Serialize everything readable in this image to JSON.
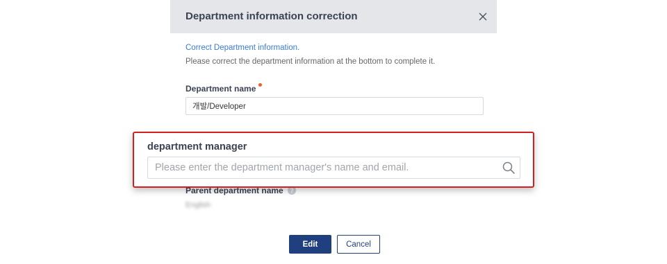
{
  "modal": {
    "title": "Department information correction",
    "close_icon": "close-icon",
    "intro_link": "Correct Department information.",
    "intro_text": "Please correct the department information at the bottom to complete it."
  },
  "dept_name": {
    "label": "Department name",
    "value": "개발/Developer",
    "required_color": "#f05a28"
  },
  "manager": {
    "label": "department manager",
    "placeholder": "Please enter the department manager's name and email.",
    "search_icon": "search-icon",
    "highlight_color": "#d31f1f"
  },
  "parent": {
    "label": "Parent department name",
    "value": "English"
  },
  "buttons": {
    "edit": "Edit",
    "cancel": "Cancel",
    "primary_color": "#1f3f7f"
  }
}
